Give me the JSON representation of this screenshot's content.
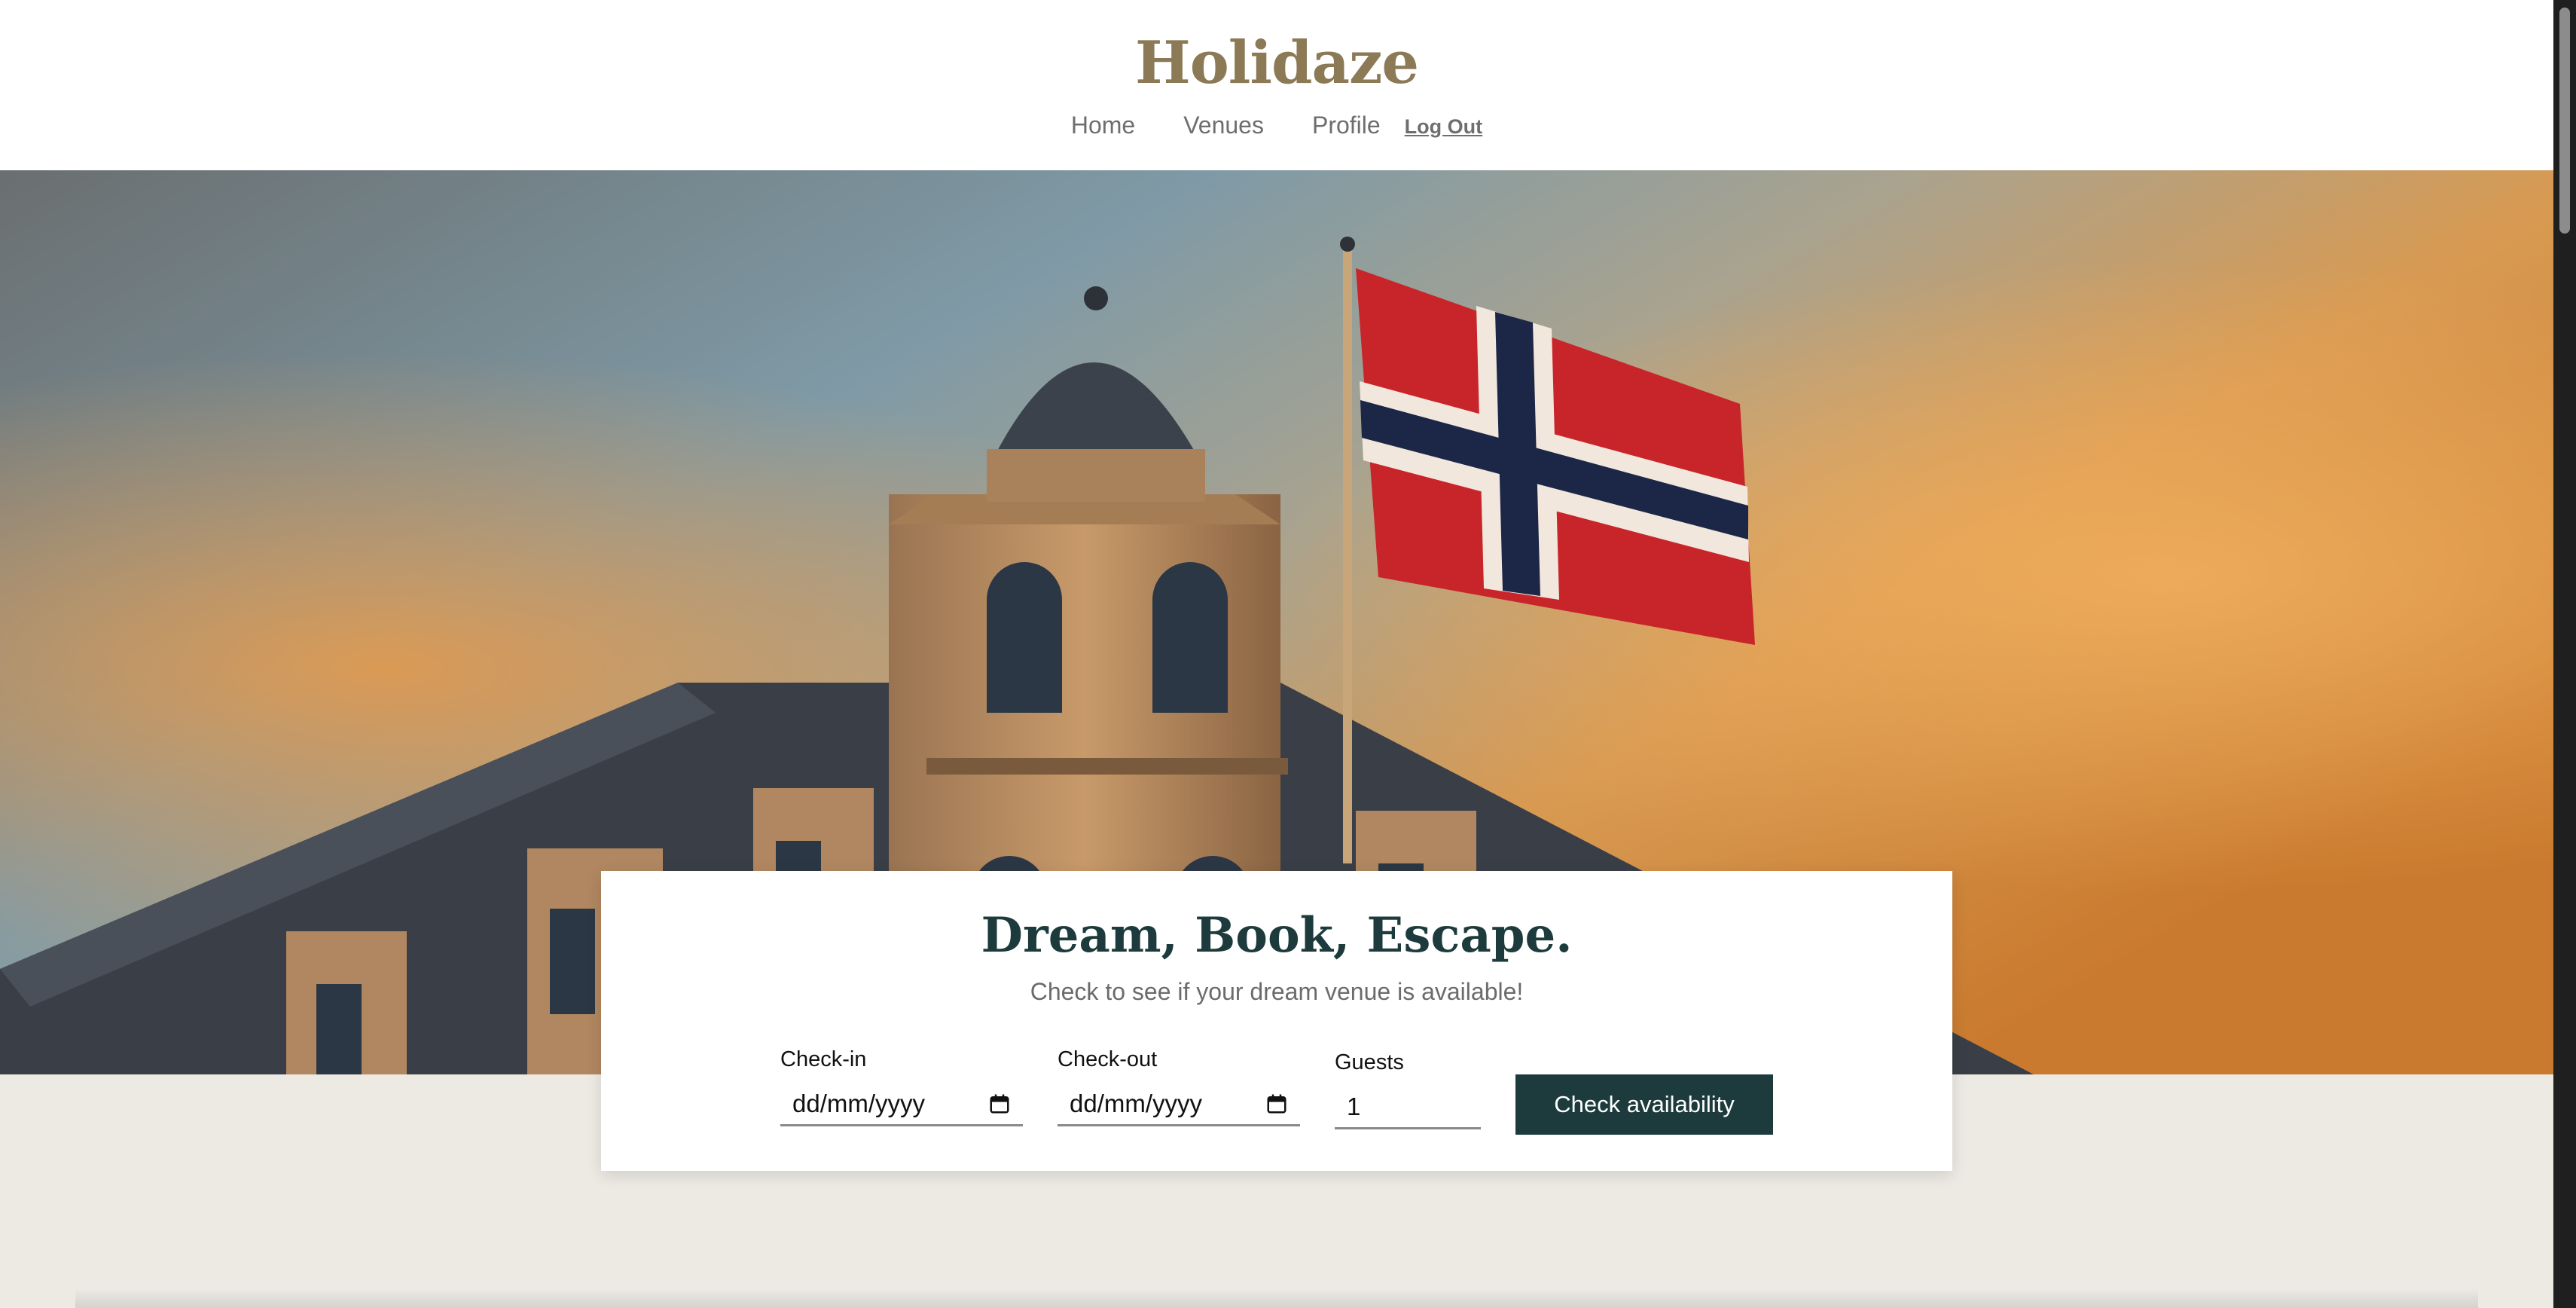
{
  "header": {
    "logo": "Holidaze",
    "nav": {
      "home": "Home",
      "venues": "Venues",
      "profile": "Profile",
      "logout": "Log Out"
    }
  },
  "hero": {
    "image_subject": "building-with-norwegian-flag"
  },
  "booking": {
    "title": "Dream, Book, Escape.",
    "subtitle": "Check to see if your dream venue is available!",
    "checkin_label": "Check-in",
    "checkin_placeholder": "dd/mm/yyyy",
    "checkout_label": "Check-out",
    "checkout_placeholder": "dd/mm/yyyy",
    "guests_label": "Guests",
    "guests_value": "1",
    "submit_label": "Check availability"
  },
  "colors": {
    "brand": "#8b7a55",
    "accent": "#1d3b3c",
    "page_bg": "#edeae4"
  },
  "icons": {
    "calendar": "calendar-icon"
  }
}
